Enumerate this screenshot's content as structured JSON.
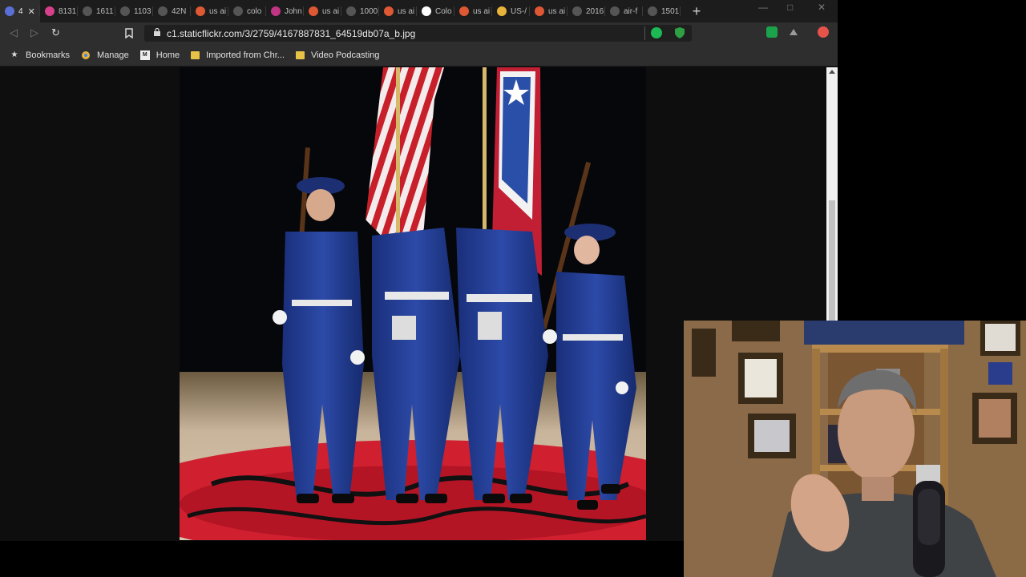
{
  "tabs": [
    {
      "label": "4",
      "favicon": "multi-dot-icon",
      "color": "#5a6fd6",
      "active": true
    },
    {
      "label": "8131",
      "favicon": "flickr-icon",
      "color": "#d63f8c"
    },
    {
      "label": "1611",
      "favicon": "blank-page-icon",
      "color": "#555555"
    },
    {
      "label": "1103",
      "favicon": "blank-page-icon",
      "color": "#555555"
    },
    {
      "label": "42N",
      "favicon": "blank-page-icon",
      "color": "#555555"
    },
    {
      "label": "us ai",
      "favicon": "duckduckgo-icon",
      "color": "#de5833"
    },
    {
      "label": "colo",
      "favicon": "blank-page-icon",
      "color": "#555555"
    },
    {
      "label": "John",
      "favicon": "instagram-icon",
      "color": "#c13584"
    },
    {
      "label": "us ai",
      "favicon": "duckduckgo-icon",
      "color": "#de5833"
    },
    {
      "label": "1000",
      "favicon": "blank-page-icon",
      "color": "#555555"
    },
    {
      "label": "us ai",
      "favicon": "duckduckgo-icon",
      "color": "#de5833"
    },
    {
      "label": "Colo",
      "favicon": "m-logo-icon",
      "color": "#ffffff"
    },
    {
      "label": "us ai",
      "favicon": "duckduckgo-icon",
      "color": "#de5833"
    },
    {
      "label": "US-/",
      "favicon": "chrome-icon",
      "color": "#e8b33a"
    },
    {
      "label": "us ai",
      "favicon": "duckduckgo-icon",
      "color": "#de5833"
    },
    {
      "label": "2016",
      "favicon": "blank-page-icon",
      "color": "#555555"
    },
    {
      "label": "air-f",
      "favicon": "blank-page-icon",
      "color": "#555555"
    },
    {
      "label": "1501",
      "favicon": "blank-page-icon",
      "color": "#555555"
    }
  ],
  "address": {
    "url": "c1.staticflickr.com/3/2759/4167887831_64519db07a_b.jpg"
  },
  "bookmarks": {
    "bookmarks_label": "Bookmarks",
    "manage_label": "Manage",
    "home_label": "Home",
    "imported_label": "Imported from Chr...",
    "video_label": "Video Podcasting"
  },
  "colors": {
    "accent_green": "#1db954",
    "shield_green": "#2ea043",
    "ext_red": "#e5534b",
    "folder_yellow": "#e8c247"
  }
}
